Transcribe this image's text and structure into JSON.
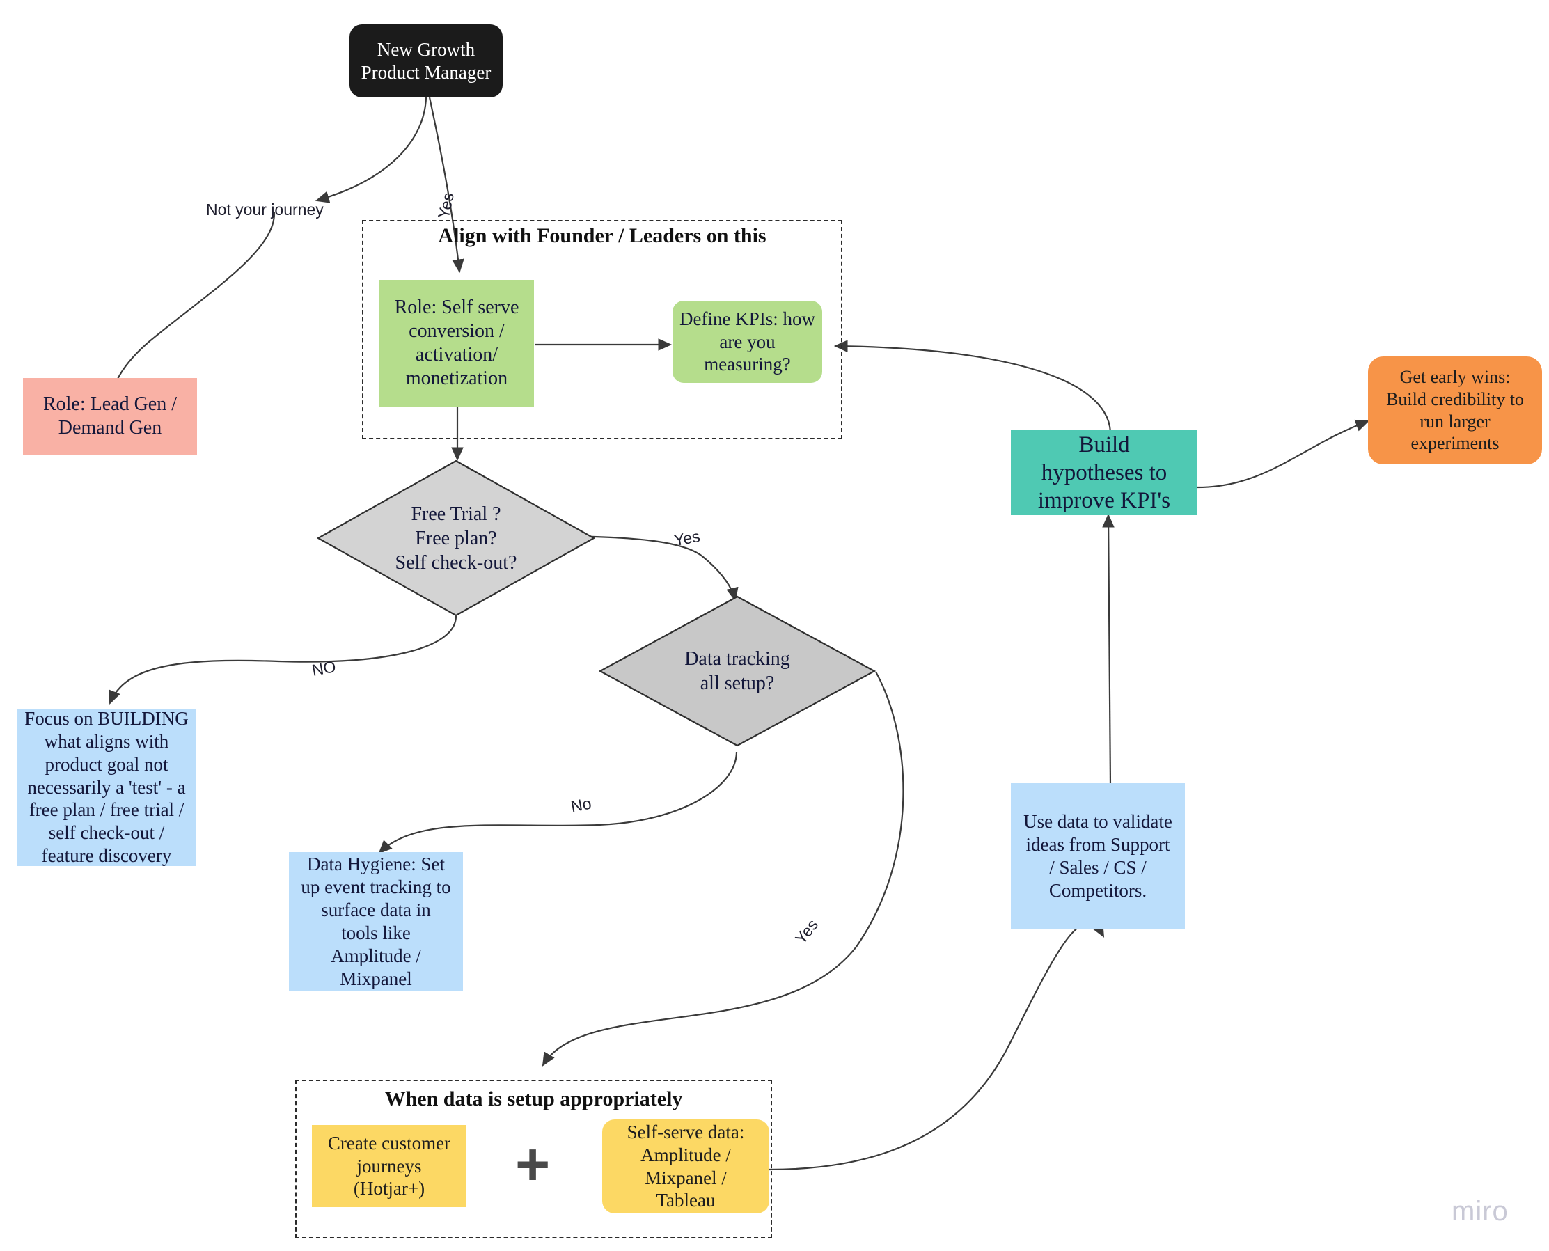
{
  "diagram": {
    "title": "Growth Product Manager journey flowchart",
    "watermark": "miro"
  },
  "nodes": {
    "start": {
      "label": "New Growth\nProduct Manager",
      "color": "#1b1b1b"
    },
    "role_lead_gen": {
      "label": "Role: Lead Gen  /\nDemand Gen",
      "color": "#f9b1a5"
    },
    "role_self_serve": {
      "label": "Role: Self serve\nconversion /\nactivation/\nmonetization",
      "color": "#b5dd8c"
    },
    "define_kpis": {
      "label": "Define KPIs: how\nare you\nmeasuring?",
      "color": "#b5dd8c"
    },
    "build_hypotheses": {
      "label": "Build\nhypotheses to\nimprove KPI's",
      "color": "#4fc9b3"
    },
    "early_wins": {
      "label": "Get early wins:\nBuild credibility to\nrun larger\nexperiments",
      "color": "#f79448"
    },
    "focus_building": {
      "label": "Focus on BUILDING\nwhat aligns with\nproduct goal not\nnecessarily a 'test' - a\nfree plan / free trial /\nself check-out /\nfeature discovery",
      "color": "#bbdefb"
    },
    "data_hygiene": {
      "label": "Data Hygiene: Set\nup event tracking to\nsurface data in\ntools like\nAmplitude /\nMixpanel",
      "color": "#bbdefb"
    },
    "use_data": {
      "label": "Use data to validate\nideas from Support\n/ Sales / CS /\nCompetitors.",
      "color": "#bbdefb"
    },
    "create_journeys": {
      "label": "Create customer\njourneys\n(Hotjar+)",
      "color": "#fcd864"
    },
    "self_serve_data": {
      "label": "Self-serve data:\nAmplitude /\nMixpanel /\nTableau",
      "color": "#fcd864"
    }
  },
  "decisions": {
    "free_trial": {
      "label": "Free Trial ?\nFree plan?\nSelf check-out?",
      "color": "#d3d3d3"
    },
    "data_tracking": {
      "label": "Data tracking\nall setup?",
      "color": "#c8c8c8"
    }
  },
  "groups": {
    "align_founder": {
      "title": "Align with Founder / Leaders on this"
    },
    "when_data": {
      "title": "When data is setup appropriately"
    }
  },
  "edge_labels": {
    "not_your_journey": "Not your journey",
    "yes_start": "Yes",
    "yes_free_trial": "Yes",
    "no_free_trial": "NO",
    "no_data_tracking": "No",
    "yes_data_tracking": "Yes"
  },
  "symbols": {
    "plus": "+"
  }
}
